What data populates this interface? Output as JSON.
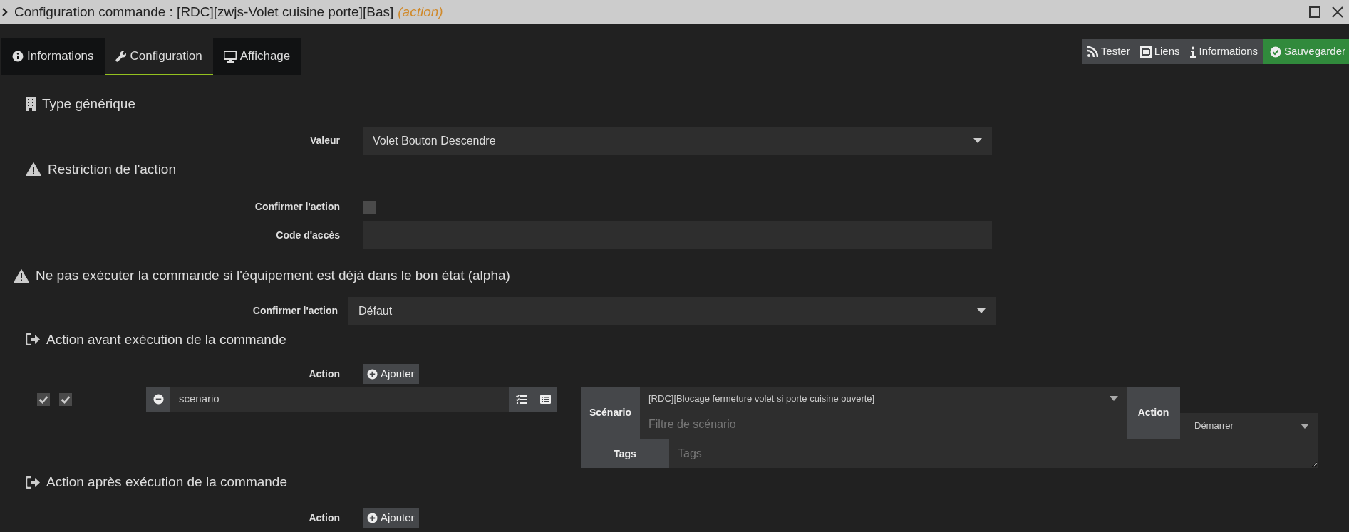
{
  "window": {
    "title": "Configuration commande : [RDC][zwjs-Volet cuisine porte][Bas]",
    "title_suffix": "(action)"
  },
  "tabs": [
    {
      "label": "Informations",
      "selected": false
    },
    {
      "label": "Configuration",
      "selected": true
    },
    {
      "label": "Affichage",
      "selected": false
    }
  ],
  "toolbar": [
    {
      "label": "Tester",
      "kind": "default"
    },
    {
      "label": "Liens",
      "kind": "default"
    },
    {
      "label": "Informations",
      "kind": "default"
    },
    {
      "label": "Sauvegarder",
      "kind": "success"
    }
  ],
  "generic_type": {
    "heading": "Type générique",
    "fields": [
      {
        "label": "Valeur",
        "kind": "select",
        "value": "Volet Bouton Descendre"
      }
    ]
  },
  "restriction": {
    "heading": "Restriction de l'action",
    "fields": [
      {
        "label": "Confirmer l'action",
        "kind": "checkbox",
        "checked": false
      },
      {
        "label": "Code d'accès",
        "kind": "text"
      }
    ]
  },
  "already_state": {
    "heading": "Ne pas exécuter la commande si l'équipement est déjà dans le bon état (alpha)",
    "fields": [
      {
        "label": "Confirmer l'action",
        "kind": "select",
        "value": "Défaut"
      }
    ]
  },
  "pre_actions": {
    "heading": "Action avant exécution de la commande",
    "add_label": "Action",
    "add_button": "Ajouter",
    "actions": [
      {
        "enabled": true,
        "background": true,
        "command": "scenario",
        "scenario_label": "Scénario",
        "scenario": "[RDC][Blocage fermeture volet si porte cuisine ouverte]",
        "filter_placeholder": "Filtre de scénario",
        "action_label": "Action",
        "action": "Démarrer",
        "tags_label": "Tags",
        "tags_placeholder": "Tags"
      }
    ]
  },
  "post_actions": {
    "heading": "Action après exécution de la commande",
    "add_label": "Action",
    "add_button": "Ajouter"
  }
}
